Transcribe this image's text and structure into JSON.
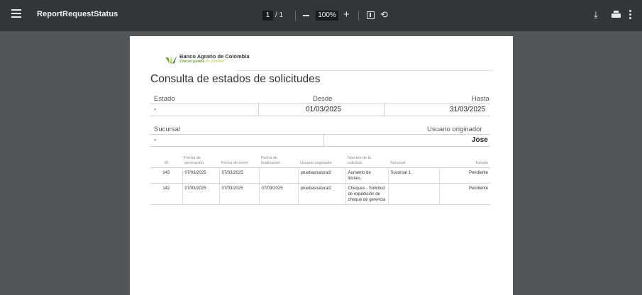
{
  "toolbar": {
    "title": "ReportRequestStatus",
    "page_current": "1",
    "page_total": "/ 1",
    "zoom": "100%",
    "icons": {
      "menu": "hamburger-icon",
      "zoom_out": "minus-icon",
      "zoom_in": "plus-icon",
      "fit": "fit-page-icon",
      "rotate": "rotate-icon",
      "download": "download-icon",
      "print": "print-icon",
      "more": "more-vert-icon"
    }
  },
  "document": {
    "logo": {
      "name": "Banco Agrario de Colombia",
      "tagline_main": "Crecer juntos",
      "tagline_accent": "es positivo"
    },
    "title": "Consulta de estados de solicitudes",
    "filters": {
      "estado_label": "Estado",
      "estado_value": "-",
      "desde_label": "Desde",
      "desde_value": "01/03/2025",
      "hasta_label": "Hasta",
      "hasta_value": "31/03/2025",
      "sucursal_label": "Sucursal",
      "sucursal_value": "-",
      "usuario_label": "Usuario originador",
      "usuario_value": "Jose"
    },
    "table": {
      "headers": {
        "id": "ID",
        "fecha_generacion": "Fecha de generación",
        "fecha_envio": "Fecha de envío",
        "fecha_finalizacion": "Fecha de finalización",
        "usuario_originador": "Usuario originador",
        "nombre_solicitud": "Nombre de la solicitud",
        "sucursal": "Sucursal",
        "estado": "Estado"
      },
      "rows": [
        {
          "id": "143",
          "fecha_generacion": "07/03/2025",
          "fecha_envio": "07/03/2025",
          "fecha_finalizacion": "",
          "usuario_originador": "pruebasnatural2",
          "nombre_solicitud": "Aumento de límites.",
          "sucursal": "Sucursal 1",
          "estado": "Pendiente"
        },
        {
          "id": "142",
          "fecha_generacion": "07/03/2025",
          "fecha_envio": "07/03/2025",
          "fecha_finalizacion": "07/03/2025",
          "usuario_originador": "pruebasnatural2",
          "nombre_solicitud": "Cheques - Solicitud de expedición de cheque de gerencia",
          "sucursal": "",
          "estado": "Pendiente"
        }
      ]
    }
  },
  "colors": {
    "toolbar_bg": "#323639",
    "viewer_bg": "#525659",
    "page_bg": "#ffffff",
    "logo_green": "#6a9c2d",
    "logo_yellow": "#c3c83a"
  }
}
